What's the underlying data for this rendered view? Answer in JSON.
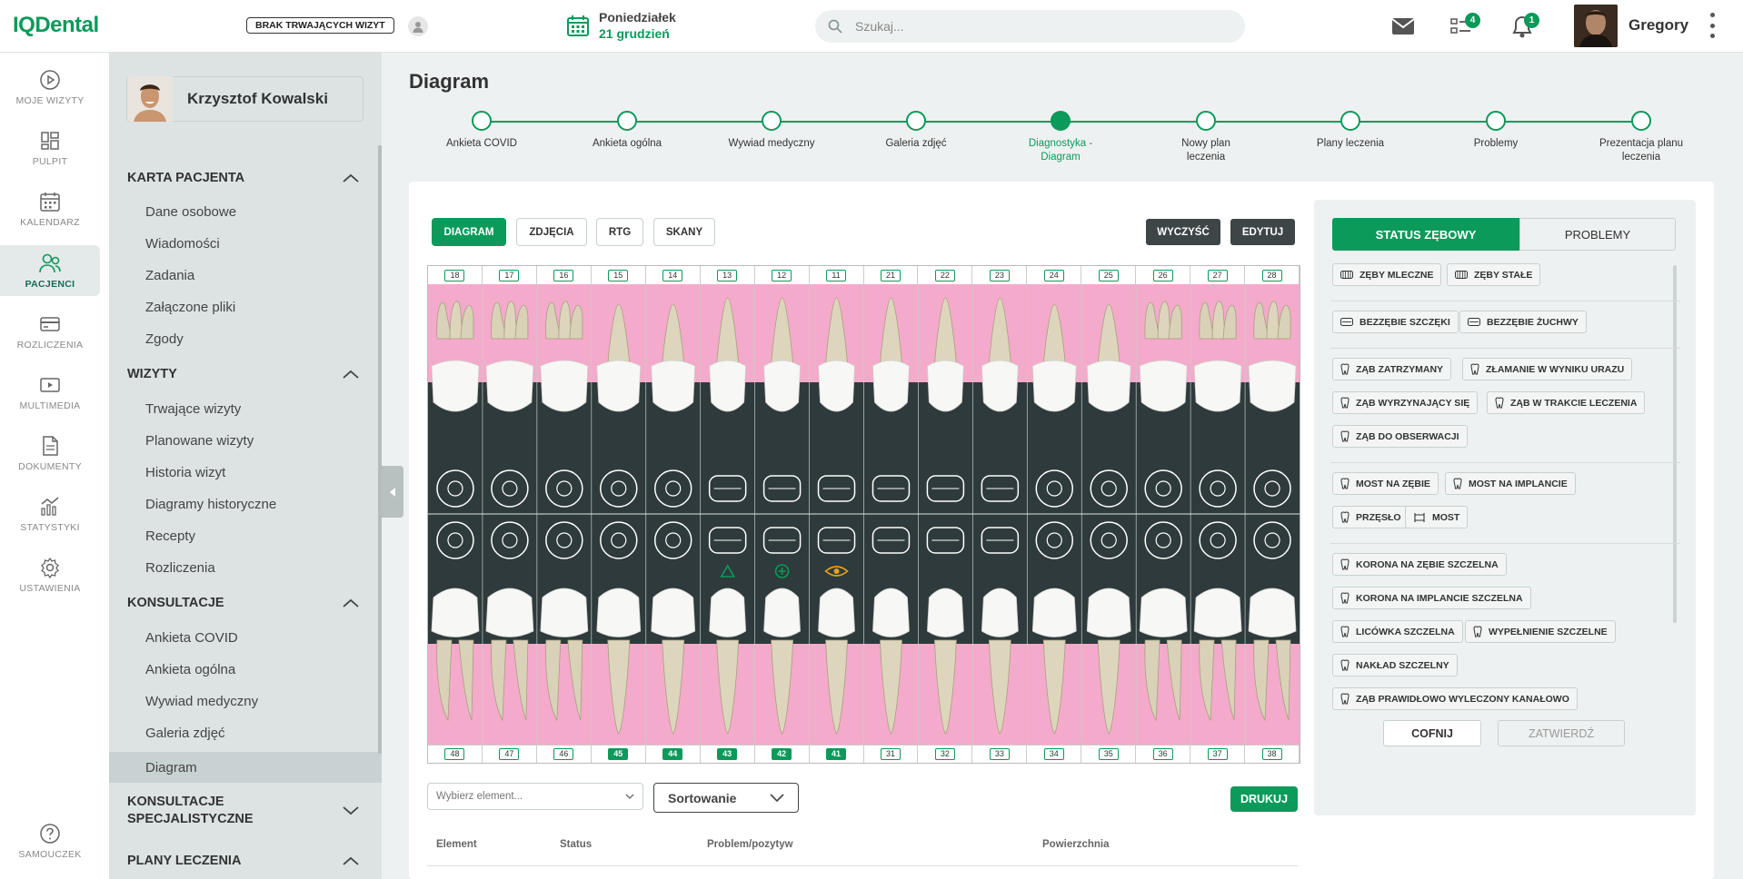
{
  "app": {
    "logo": "IQDental"
  },
  "topbar": {
    "visit_badge": "BRAK TRWAJĄCYCH WIZYT",
    "date_day": "Poniedziałek",
    "date_value": "21 grudzień",
    "search_placeholder": "Szukaj...",
    "tasks_count": "4",
    "notifications_count": "1",
    "user_name": "Gregory"
  },
  "nav": {
    "items": [
      {
        "label": "MOJE WIZYTY",
        "icon": "play-circle-icon"
      },
      {
        "label": "PULPIT",
        "icon": "dashboard-icon"
      },
      {
        "label": "KALENDARZ",
        "icon": "calendar-icon"
      },
      {
        "label": "PACJENCI",
        "icon": "patients-icon",
        "active": true
      },
      {
        "label": "ROZLICZENIA",
        "icon": "credit-card-icon"
      },
      {
        "label": "MULTIMEDIA",
        "icon": "media-icon"
      },
      {
        "label": "DOKUMENTY",
        "icon": "document-icon"
      },
      {
        "label": "STATYSTYKI",
        "icon": "stats-icon"
      },
      {
        "label": "USTAWIENIA",
        "icon": "gear-icon"
      }
    ],
    "help": "SAMOUCZEK"
  },
  "patient": {
    "name": "Krzysztof Kowalski"
  },
  "sidebar": {
    "karta": {
      "title": "KARTA PACJENTA",
      "items": [
        "Dane osobowe",
        "Wiadomości",
        "Zadania",
        "Załączone pliki",
        "Zgody"
      ]
    },
    "wizyty": {
      "title": "WIZYTY",
      "items": [
        "Trwające wizyty",
        "Planowane wizyty",
        "Historia wizyt",
        "Diagramy historyczne",
        "Recepty",
        "Rozliczenia"
      ]
    },
    "konsultacje": {
      "title": "KONSULTACJE",
      "items": [
        "Ankieta COVID",
        "Ankieta ogólna",
        "Wywiad medyczny",
        "Galeria zdjęć",
        "Diagram"
      ]
    },
    "konsultacje_spec": {
      "title_line1": "KONSULTACJE",
      "title_line2": "SPECJALISTYCZNE"
    },
    "plany": {
      "title": "PLANY LECZENIA"
    }
  },
  "main": {
    "title": "Diagram",
    "steps": [
      {
        "l1": "Ankieta COVID",
        "l2": ""
      },
      {
        "l1": "Ankieta ogólna",
        "l2": ""
      },
      {
        "l1": "Wywiad medyczny",
        "l2": ""
      },
      {
        "l1": "Galeria zdjęć",
        "l2": ""
      },
      {
        "l1": "Diagnostyka -",
        "l2": "Diagram",
        "active": true
      },
      {
        "l1": "Nowy plan",
        "l2": "leczenia"
      },
      {
        "l1": "Plany leczenia",
        "l2": ""
      },
      {
        "l1": "Problemy",
        "l2": ""
      },
      {
        "l1": "Prezentacja planu",
        "l2": "leczenia"
      }
    ],
    "tabs": [
      "DIAGRAM",
      "ZDJĘCIA",
      "RTG",
      "SKANY"
    ],
    "clear_label": "WYCZYŚĆ",
    "edit_label": "EDYTUJ",
    "upper_numbers": [
      "18",
      "17",
      "16",
      "15",
      "14",
      "13",
      "12",
      "11",
      "21",
      "22",
      "23",
      "24",
      "25",
      "26",
      "27",
      "28"
    ],
    "lower_numbers": [
      "48",
      "47",
      "46",
      "45",
      "44",
      "43",
      "42",
      "41",
      "31",
      "32",
      "33",
      "34",
      "35",
      "36",
      "37",
      "38"
    ],
    "lower_selected": [
      "45",
      "44",
      "43",
      "42",
      "41"
    ],
    "select_placeholder": "Wybierz element...",
    "sort_label": "Sortowanie",
    "print_label": "DRUKUJ",
    "table_headers": [
      "Element",
      "Status",
      "Problem/pozytyw",
      "Powierzchnia"
    ]
  },
  "status_panel": {
    "tab_status": "STATUS ZĘBOWY",
    "tab_problems": "PROBLEMY",
    "options": [
      "ZĘBY MLECZNE",
      "ZĘBY STAŁE",
      "BEZZĘBIE SZCZĘKI",
      "BEZZĘBIE ŻUCHWY",
      "ZĄB ZATRZYMANY",
      "ZŁAMANIE W WYNIKU URAZU",
      "ZĄB WYRZYNAJĄCY SIĘ",
      "ZĄB W TRAKCIE LECZENIA",
      "ZĄB DO OBSERWACJI",
      "MOST NA ZĘBIE",
      "MOST NA IMPLANCIE",
      "PRZĘSŁO",
      "MOST",
      "KORONA NA ZĘBIE SZCZELNA",
      "KORONA NA IMPLANCIE SZCZELNA",
      "LICÓWKA SZCZELNA",
      "WYPEŁNIENIE SZCZELNE",
      "NAKŁAD SZCZELNY",
      "ZĄB PRAWIDŁOWO WYLECZONY KANAŁOWO"
    ],
    "undo_label": "COFNIJ",
    "confirm_label": "ZATWIERDŹ"
  },
  "colors": {
    "accent": "#0b9a5a",
    "gum": "#f4aacb",
    "dark": "#2e3a3c"
  }
}
